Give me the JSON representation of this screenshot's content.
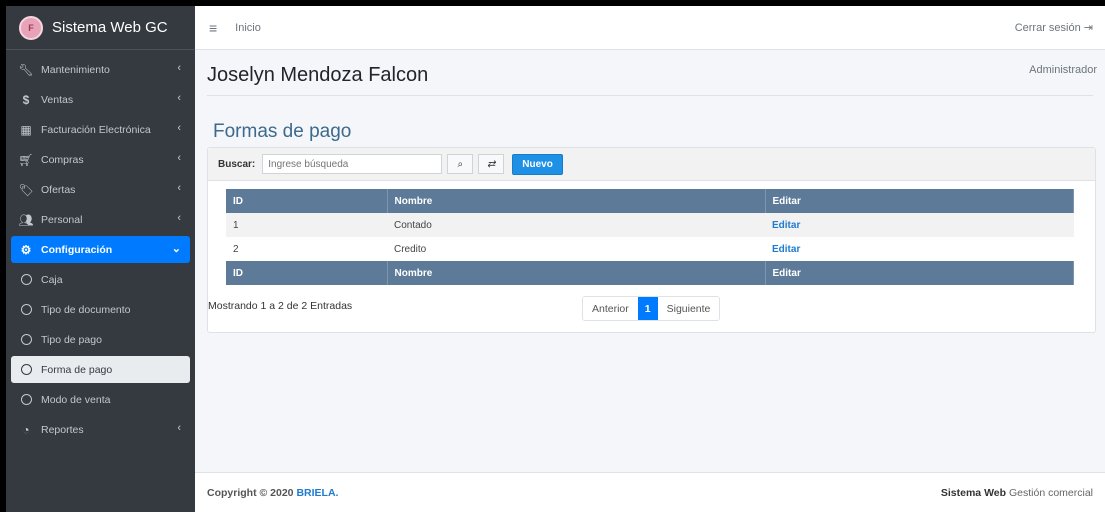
{
  "sidebar": {
    "brand": "Sistema Web GC",
    "items": [
      {
        "label": "Mantenimiento",
        "icon": "wrench-icon"
      },
      {
        "label": "Ventas",
        "icon": "dollar-icon"
      },
      {
        "label": "Facturación Electrónica",
        "icon": "building-icon"
      },
      {
        "label": "Compras",
        "icon": "cart-icon"
      },
      {
        "label": "Ofertas",
        "icon": "tags-icon"
      },
      {
        "label": "Personal",
        "icon": "users-icon"
      },
      {
        "label": "Configuración",
        "icon": "gear-icon"
      },
      {
        "label": "Caja",
        "icon": "circle-icon"
      },
      {
        "label": "Tipo de documento",
        "icon": "circle-icon"
      },
      {
        "label": "Tipo de pago",
        "icon": "circle-icon"
      },
      {
        "label": "Forma de pago",
        "icon": "circle-icon"
      },
      {
        "label": "Modo de venta",
        "icon": "circle-icon"
      },
      {
        "label": "Reportes",
        "icon": "pie-chart-icon"
      }
    ]
  },
  "topbar": {
    "home": "Inicio",
    "logout": "Cerrar sesión"
  },
  "main": {
    "user_name": "Joselyn Mendoza Falcon",
    "role": "Administrador",
    "page_title": "Formas de pago",
    "search_label": "Buscar:",
    "search_placeholder": "Ingrese búsqueda",
    "new_button": "Nuevo",
    "table": {
      "headers": [
        "ID",
        "Nombre",
        "Editar"
      ],
      "rows": [
        [
          "1",
          "Contado",
          "Editar"
        ],
        [
          "2",
          "Credito",
          "Editar"
        ]
      ]
    },
    "entries_info": "Mostrando 1 a 2 de 2 Entradas",
    "pagination": {
      "prev": "Anterior",
      "current": "1",
      "next": "Siguiente"
    }
  },
  "footer": {
    "copyright": "Copyright © 2020",
    "company": "BRIELA.",
    "system_bold": "Sistema Web",
    "system_rest": "Gestión comercial"
  },
  "colors": {
    "accent": "#007bff",
    "sidebar": "#343a40",
    "table_header": "#5d7b99"
  }
}
